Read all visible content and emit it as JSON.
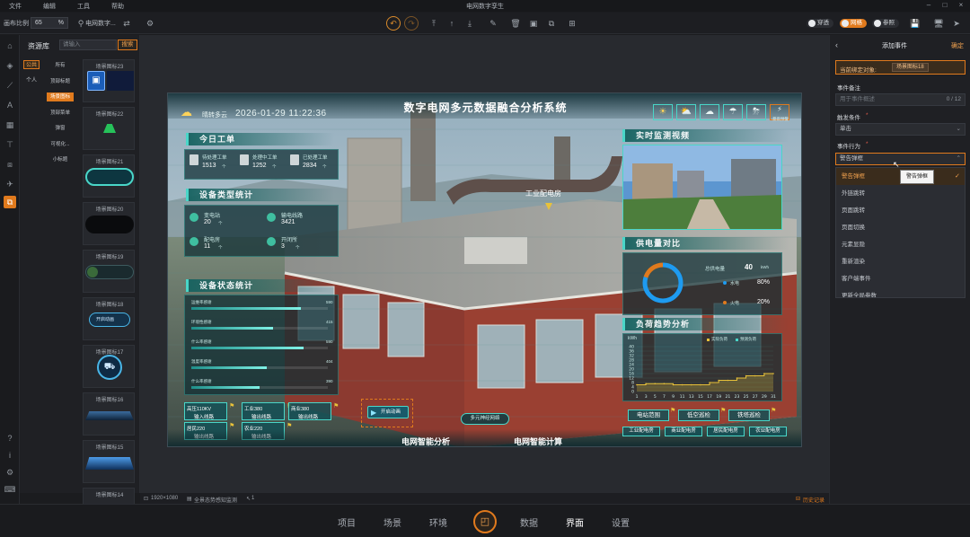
{
  "menubar": {
    "items": [
      "文件",
      "编辑",
      "工具",
      "帮助"
    ],
    "title": "电网数字孪生"
  },
  "toolbar": {
    "canvas_ratio_label": "画布比例",
    "canvas_ratio_value": "65",
    "percent": "%",
    "project_name": "电网数字...",
    "toggles": [
      {
        "label": "穿透",
        "on": false
      },
      {
        "label": "网格",
        "on": true
      },
      {
        "label": "参照",
        "on": false
      }
    ]
  },
  "resources": {
    "title": "资源库",
    "search_placeholder": "请输入",
    "search_button": "搜索",
    "level1": [
      {
        "label": "公共",
        "active": true
      },
      {
        "label": "个人",
        "active": false
      }
    ],
    "level2": [
      {
        "label": "所有",
        "active": false
      },
      {
        "label": "顶部标题",
        "active": false
      },
      {
        "label": "场景图标",
        "active": true
      },
      {
        "label": "顶部菜单",
        "active": false
      },
      {
        "label": "弹窗",
        "active": false
      },
      {
        "label": "可视化...",
        "active": false
      },
      {
        "label": "小标题",
        "active": false
      }
    ],
    "assets": [
      "场景图标23",
      "场景图标22",
      "场景图标21",
      "场景图标20",
      "场景图标19",
      "场景图标18",
      "场景图标17",
      "场景图标16",
      "场景图标15",
      "场景图标14"
    ],
    "asset18_text": "开启动画"
  },
  "scene": {
    "main_title": "数字电网多元数据融合分析系统",
    "weather": "晴转多云",
    "datetime": "2026-01-29 11:22:36",
    "weather_icon_caption": "暴雨预警",
    "today_orders": {
      "title": "今日工单",
      "items": [
        {
          "label": "待处理工单",
          "value": "1513",
          "unit": "个"
        },
        {
          "label": "处理中工单",
          "value": "1252",
          "unit": "个"
        },
        {
          "label": "已处理工单",
          "value": "2834",
          "unit": "个"
        }
      ]
    },
    "device_types": {
      "title": "设备类型统计",
      "items": [
        {
          "label": "变电站",
          "value": "20",
          "unit": "个"
        },
        {
          "label": "输电线路",
          "value": "3421",
          "unit": ""
        },
        {
          "label": "配电房",
          "value": "11",
          "unit": "个"
        },
        {
          "label": "开闭所",
          "value": "3",
          "unit": "个"
        }
      ]
    },
    "device_status": {
      "title": "设备状态统计",
      "rows": [
        {
          "label": "运维率感谢",
          "value": "590",
          "ratio": 0.8
        },
        {
          "label": "环境性感谢",
          "value": "415",
          "ratio": 0.6
        },
        {
          "label": "什么率感谢",
          "value": "590",
          "ratio": 0.82
        },
        {
          "label": "温度率感谢",
          "value": "404",
          "ratio": 0.55
        },
        {
          "label": "什么率感谢",
          "value": "390",
          "ratio": 0.5
        }
      ]
    },
    "voltage_buttons": [
      {
        "line1": "高压110KV",
        "line2": "输入线路"
      },
      {
        "line1": "工业380",
        "line2": "输出线路"
      },
      {
        "line1": "商业380",
        "line2": "输出线路"
      },
      {
        "line1": "居民220",
        "line2": "输出线路"
      },
      {
        "line1": "农业220",
        "line2": "输出线路"
      }
    ],
    "factory_label": "工业配电房",
    "anim_button": "开启动画",
    "mid_button": "多元神经网络",
    "bottom_left_title": "电网智能分析",
    "bottom_right_title": "电网智能计算",
    "video": {
      "title": "实时监测视频"
    },
    "power_supply": {
      "title": "供电量对比",
      "total_label": "总供电量",
      "total_value": "40",
      "total_unit": "kWh",
      "items": [
        {
          "label": "水电",
          "value": "80%"
        },
        {
          "label": "火电",
          "value": "20%"
        }
      ],
      "ring_ratio": 0.8
    },
    "load_trend": {
      "title": "负荷趋势分析",
      "unit": "kWh",
      "legend": [
        "实际负荷",
        "预测负荷"
      ]
    },
    "right_buttons_top": [
      "电站范围",
      "低空巡检",
      "铁塔巡检"
    ],
    "right_buttons_bottom": [
      "工业配电房",
      "商业配电房",
      "居民配电房",
      "农业配电房"
    ],
    "colors": {
      "accent": "#49d6c8",
      "orange": "#e07a1d",
      "chart_line": "#e8c23a",
      "ring": "#1e9bf0"
    }
  },
  "chart_data": {
    "type": "area",
    "x": [
      1,
      3,
      5,
      7,
      9,
      11,
      13,
      15,
      17,
      19,
      21,
      23,
      25,
      27,
      29,
      31
    ],
    "series": [
      {
        "name": "实际负荷",
        "values": [
          6,
          7,
          7,
          7,
          6,
          6,
          6,
          6,
          8,
          10,
          10,
          12,
          14,
          14,
          16,
          16
        ]
      }
    ],
    "ylabel": "kWh",
    "ylim": [
      0,
      40
    ],
    "yticks": [
      0,
      4,
      8,
      12,
      16,
      20,
      24,
      28,
      32,
      36,
      40
    ],
    "legend": [
      "实际负荷",
      "预测负荷"
    ],
    "legend_position": "top-right"
  },
  "statusbar": {
    "resolution": "1920×1080",
    "layer_name": "全景态势感知监测",
    "count": "1",
    "history": "历史记录"
  },
  "rightpanel": {
    "title": "添加事件",
    "confirm": "确定",
    "bound_label": "当前绑定对象:",
    "bound_value": "场景图标18",
    "note_label": "事件备注",
    "note_placeholder": "用于事件概述",
    "note_count": "0 / 12",
    "trigger_label": "触发条件",
    "trigger_value": "单击",
    "action_label": "事件行为",
    "action_value": "警告弹框",
    "tooltip": "警告弹框",
    "options": [
      "警告弹框",
      "外链跳转",
      "页面跳转",
      "页面切换",
      "元素显隐",
      "重新渲染",
      "客户端事件",
      "更新全局参数"
    ]
  },
  "bottomnav": {
    "items": [
      "项目",
      "场景",
      "环境",
      "数据",
      "界面",
      "设置"
    ],
    "active": "界面"
  }
}
